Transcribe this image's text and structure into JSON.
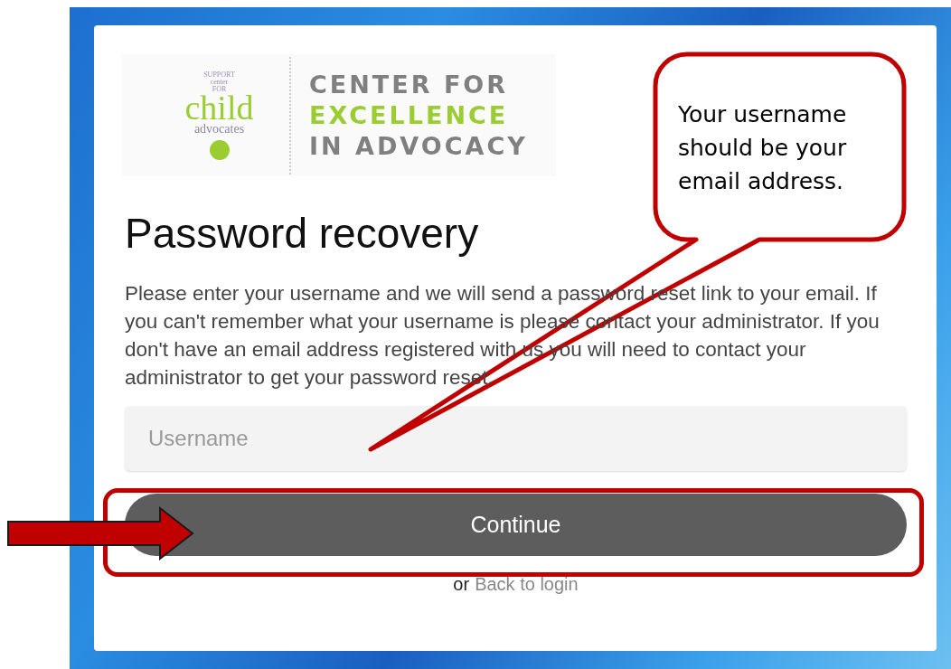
{
  "logo": {
    "small_lines": [
      "SUPPORT",
      "center",
      "FOR"
    ],
    "big_word": "child",
    "sub_word": "advocates",
    "title_lines": [
      {
        "text": "CENTER FOR",
        "color": "#808080"
      },
      {
        "text": "EXCELLENCE",
        "color": "#9acd32"
      },
      {
        "text": "IN ADVOCACY",
        "color": "#808080"
      }
    ]
  },
  "heading": "Password recovery",
  "description": "Please enter your username and we will send a password reset link to your email. If you can't remember what your username is please contact your administrator. If you don't have an email address registered with us you will need to contact your administrator to get your password reset.",
  "username_field": {
    "placeholder": "Username"
  },
  "continue_button": "Continue",
  "back_link": {
    "prefix": "or",
    "label": "Back to login"
  },
  "callout": {
    "text": "Your username should be your email address."
  }
}
